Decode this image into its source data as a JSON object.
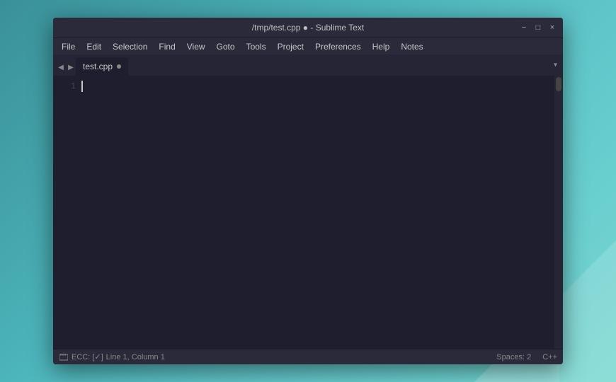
{
  "window": {
    "title": "/tmp/test.cpp ● - Sublime Text",
    "controls": {
      "minimize": "−",
      "maximize": "□",
      "close": "×"
    }
  },
  "menubar": {
    "items": [
      {
        "label": "File"
      },
      {
        "label": "Edit"
      },
      {
        "label": "Selection"
      },
      {
        "label": "Find"
      },
      {
        "label": "View"
      },
      {
        "label": "Goto"
      },
      {
        "label": "Tools"
      },
      {
        "label": "Project"
      },
      {
        "label": "Preferences"
      },
      {
        "label": "Help"
      },
      {
        "label": "Notes"
      }
    ]
  },
  "tabs": {
    "nav_left": "◀",
    "nav_right": "▶",
    "active_tab": "test.cpp",
    "dropdown": "▾"
  },
  "editor": {
    "line_count": 1,
    "lines": [
      "1"
    ]
  },
  "statusbar": {
    "ecc_text": "ECC: [✓]",
    "position": "Line 1, Column 1",
    "spaces": "Spaces: 2",
    "syntax": "C++"
  }
}
